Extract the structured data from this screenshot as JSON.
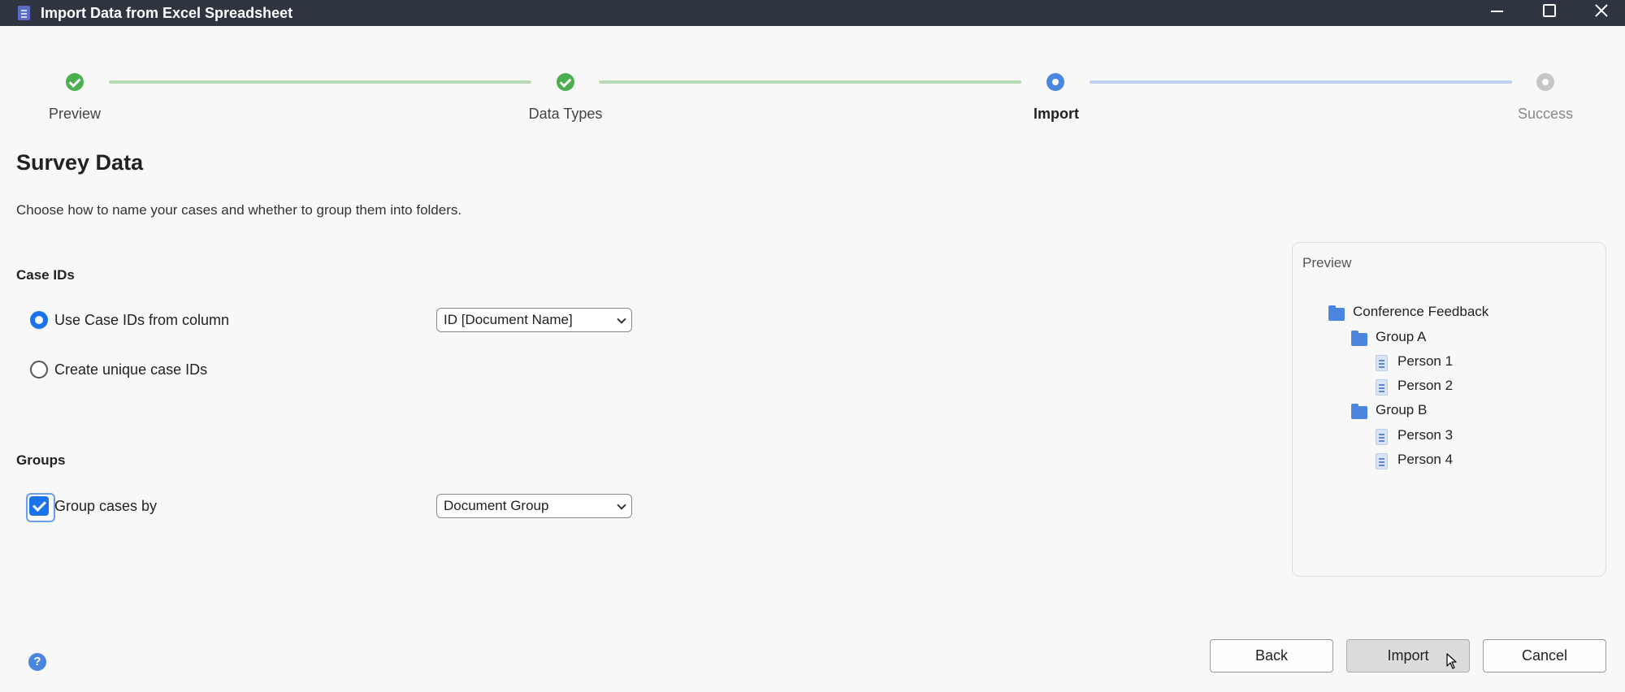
{
  "window": {
    "title": "Import Data from Excel Spreadsheet"
  },
  "steps": [
    {
      "label": "Preview",
      "state": "done"
    },
    {
      "label": "Data Types",
      "state": "done"
    },
    {
      "label": "Import",
      "state": "current"
    },
    {
      "label": "Success",
      "state": "pending"
    }
  ],
  "page": {
    "title": "Survey Data",
    "subtitle": "Choose how to name your cases and whether to group them into folders."
  },
  "case_ids": {
    "heading": "Case IDs",
    "option_column_label": "Use Case IDs from column",
    "option_column_selected": true,
    "column_select_value": "ID [Document Name]",
    "option_unique_label": "Create unique case IDs"
  },
  "groups": {
    "heading": "Groups",
    "group_by_label": "Group cases by",
    "group_by_checked": true,
    "group_select_value": "Document Group"
  },
  "preview": {
    "title": "Preview",
    "root": "Conference Feedback",
    "groups": [
      {
        "name": "Group A",
        "items": [
          "Person 1",
          "Person 2"
        ]
      },
      {
        "name": "Group B",
        "items": [
          "Person 3",
          "Person 4"
        ]
      }
    ]
  },
  "buttons": {
    "back": "Back",
    "import": "Import",
    "cancel": "Cancel"
  },
  "help_icon": "question-icon",
  "colors": {
    "accent": "#1a73e8",
    "done": "#4bae4f",
    "current": "#4a87e0",
    "titlebar": "#2f3441"
  }
}
